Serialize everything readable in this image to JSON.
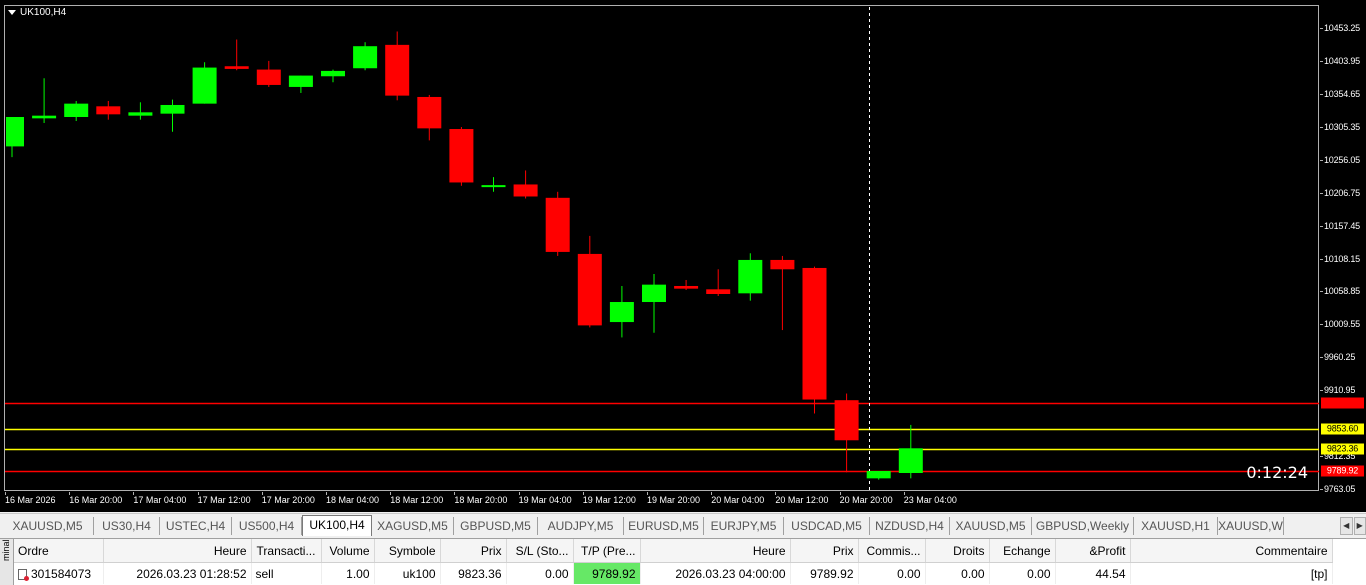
{
  "chart": {
    "title": "UK100,H4",
    "timer": "0:12:24",
    "colors": {
      "bull": "#00ff00",
      "bear": "#ff0000",
      "wick": "#00ff00",
      "crosshair": "#ffffff",
      "sl_line": "#ff0000",
      "tp_line": "#ffff00"
    },
    "price_axis": [
      "10453.25",
      "10403.95",
      "10354.65",
      "10305.35",
      "10256.05",
      "10206.75",
      "10157.45",
      "10108.15",
      "10058.85",
      "10009.55",
      "9960.25",
      "9910.95",
      "9812.35",
      "9763.05"
    ],
    "price_badges": [
      {
        "value": "9891.40",
        "color": "#ff0000",
        "text_color": "#ff0000"
      },
      {
        "value": "9853.60",
        "color": "#ffff00",
        "text_color": "#000000"
      },
      {
        "value": "9823.36",
        "color": "#ffff00",
        "text_color": "#000000"
      },
      {
        "value": "9789.92",
        "color": "#ff0000",
        "text_color": "#ffffff"
      }
    ],
    "time_axis": [
      "16 Mar 2026",
      "16 Mar 20:00",
      "17 Mar 04:00",
      "17 Mar 12:00",
      "17 Mar 20:00",
      "18 Mar 04:00",
      "18 Mar 12:00",
      "18 Mar 20:00",
      "19 Mar 04:00",
      "19 Mar 12:00",
      "19 Mar 20:00",
      "20 Mar 04:00",
      "20 Mar 12:00",
      "20 Mar 20:00",
      "23 Mar 04:00"
    ],
    "horizontal_lines": [
      {
        "price": 9891.4,
        "color": "#ff0000"
      },
      {
        "price": 9853.6,
        "color": "#ffff00"
      },
      {
        "price": 9823.36,
        "color": "#ffff00"
      },
      {
        "price": 9789.92,
        "color": "#ff0000"
      }
    ]
  },
  "chart_data": {
    "type": "candlestick",
    "title": "UK100,H4",
    "ylim": [
      9745,
      10475
    ],
    "candles": [
      {
        "open": 10276,
        "high": 10295,
        "low": 10260,
        "close": 10320,
        "dir": "up"
      },
      {
        "open": 10318,
        "high": 10378,
        "low": 10311,
        "close": 10322,
        "dir": "up"
      },
      {
        "open": 10320,
        "high": 10344,
        "low": 10314,
        "close": 10340,
        "dir": "up"
      },
      {
        "open": 10336,
        "high": 10344,
        "low": 10316,
        "close": 10324,
        "dir": "down"
      },
      {
        "open": 10322,
        "high": 10342,
        "low": 10316,
        "close": 10327,
        "dir": "up"
      },
      {
        "open": 10325,
        "high": 10346,
        "low": 10298,
        "close": 10338,
        "dir": "up"
      },
      {
        "open": 10340,
        "high": 10402,
        "low": 10340,
        "close": 10394,
        "dir": "up"
      },
      {
        "open": 10396,
        "high": 10436,
        "low": 10390,
        "close": 10392,
        "dir": "down"
      },
      {
        "open": 10391,
        "high": 10404,
        "low": 10365,
        "close": 10368,
        "dir": "down"
      },
      {
        "open": 10365,
        "high": 10382,
        "low": 10356,
        "close": 10382,
        "dir": "up"
      },
      {
        "open": 10381,
        "high": 10391,
        "low": 10372,
        "close": 10389,
        "dir": "up"
      },
      {
        "open": 10393,
        "high": 10432,
        "low": 10390,
        "close": 10426,
        "dir": "up"
      },
      {
        "open": 10428,
        "high": 10448,
        "low": 10345,
        "close": 10352,
        "dir": "down"
      },
      {
        "open": 10350,
        "high": 10353,
        "low": 10285,
        "close": 10303,
        "dir": "down"
      },
      {
        "open": 10302,
        "high": 10305,
        "low": 10217,
        "close": 10222,
        "dir": "down"
      },
      {
        "open": 10218,
        "high": 10230,
        "low": 10208,
        "close": 10218,
        "dir": "up"
      },
      {
        "open": 10219,
        "high": 10240,
        "low": 10198,
        "close": 10201,
        "dir": "down"
      },
      {
        "open": 10199,
        "high": 10208,
        "low": 10112,
        "close": 10118,
        "dir": "down"
      },
      {
        "open": 10115,
        "high": 10142,
        "low": 10005,
        "close": 10008,
        "dir": "down"
      },
      {
        "open": 10013,
        "high": 10067,
        "low": 9990,
        "close": 10043,
        "dir": "up"
      },
      {
        "open": 10043,
        "high": 10085,
        "low": 9997,
        "close": 10069,
        "dir": "up"
      },
      {
        "open": 10067,
        "high": 10076,
        "low": 10061,
        "close": 10063,
        "dir": "down"
      },
      {
        "open": 10062,
        "high": 10092,
        "low": 10052,
        "close": 10055,
        "dir": "down"
      },
      {
        "open": 10056,
        "high": 10116,
        "low": 10045,
        "close": 10106,
        "dir": "up"
      },
      {
        "open": 10106,
        "high": 10112,
        "low": 10001,
        "close": 10092,
        "dir": "down"
      },
      {
        "open": 10094,
        "high": 10096,
        "low": 9876,
        "close": 9897,
        "dir": "down"
      },
      {
        "open": 9896,
        "high": 9906,
        "low": 9788,
        "close": 9836,
        "dir": "down"
      },
      {
        "open": 9779,
        "high": 9786,
        "low": 9777,
        "close": 9790,
        "dir": "up"
      },
      {
        "open": 9787,
        "high": 9859,
        "low": 9779,
        "close": 9824,
        "dir": "up"
      }
    ]
  },
  "tabs": [
    {
      "label": "XAUUSD,M5",
      "active": false
    },
    {
      "label": "US30,H4",
      "active": false
    },
    {
      "label": "USTEC,H4",
      "active": false
    },
    {
      "label": "US500,H4",
      "active": false
    },
    {
      "label": "UK100,H4",
      "active": true
    },
    {
      "label": "XAGUSD,M5",
      "active": false
    },
    {
      "label": "GBPUSD,M5",
      "active": false
    },
    {
      "label": "AUDJPY,M5",
      "active": false
    },
    {
      "label": "EURUSD,M5",
      "active": false
    },
    {
      "label": "EURJPY,M5",
      "active": false
    },
    {
      "label": "USDCAD,M5",
      "active": false
    },
    {
      "label": "NZDUSD,H4",
      "active": false
    },
    {
      "label": "XAUUSD,M5",
      "active": false
    },
    {
      "label": "GBPUSD,Weekly",
      "active": false
    },
    {
      "label": "XAUUSD,H1",
      "active": false
    },
    {
      "label": "XAUUSD,W",
      "active": false
    }
  ],
  "terminal": {
    "side_label": "minal",
    "columns": [
      "Ordre",
      "Heure",
      "Transacti...",
      "Volume",
      "Symbole",
      "Prix",
      "S/L (Sto...",
      "T/P (Pre...",
      "Heure",
      "Prix",
      "Commis...",
      "Droits",
      "Echange",
      "&Profit",
      "Commentaire"
    ],
    "row": [
      "301584073",
      "2026.03.23 01:28:52",
      "sell",
      "1.00",
      "uk100",
      "9823.36",
      "0.00",
      "9789.92",
      "2026.03.23 04:00:00",
      "9789.92",
      "0.00",
      "0.00",
      "0.00",
      "44.54",
      "[tp]"
    ]
  }
}
